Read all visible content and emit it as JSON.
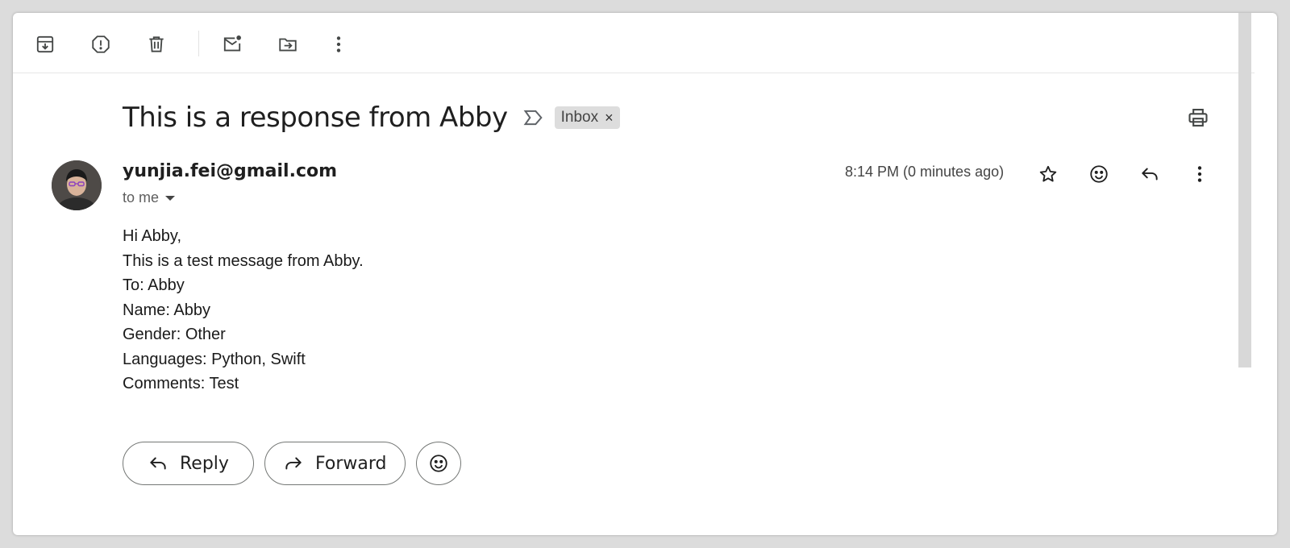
{
  "toolbar": {
    "icons": [
      "archive-icon",
      "report-spam-icon",
      "delete-icon",
      "mark-unread-icon",
      "move-to-icon",
      "more-vert-icon"
    ]
  },
  "email": {
    "subject": "This is a response from Abby",
    "label_chip": "Inbox",
    "chip_close": "×",
    "sender": "yunjia.fei@gmail.com",
    "recipient": "to me",
    "timestamp": "8:14 PM (0 minutes ago)",
    "body_lines": [
      "Hi Abby,",
      "This is a test message from Abby.",
      "To: Abby",
      "Name: Abby",
      "Gender: Other",
      "Languages: Python, Swift",
      "Comments: Test"
    ]
  },
  "actions": {
    "reply_label": "Reply",
    "forward_label": "Forward"
  },
  "colors": {
    "icon": "#444746",
    "chip_bg": "#dddddd",
    "pill_border": "#747775"
  }
}
